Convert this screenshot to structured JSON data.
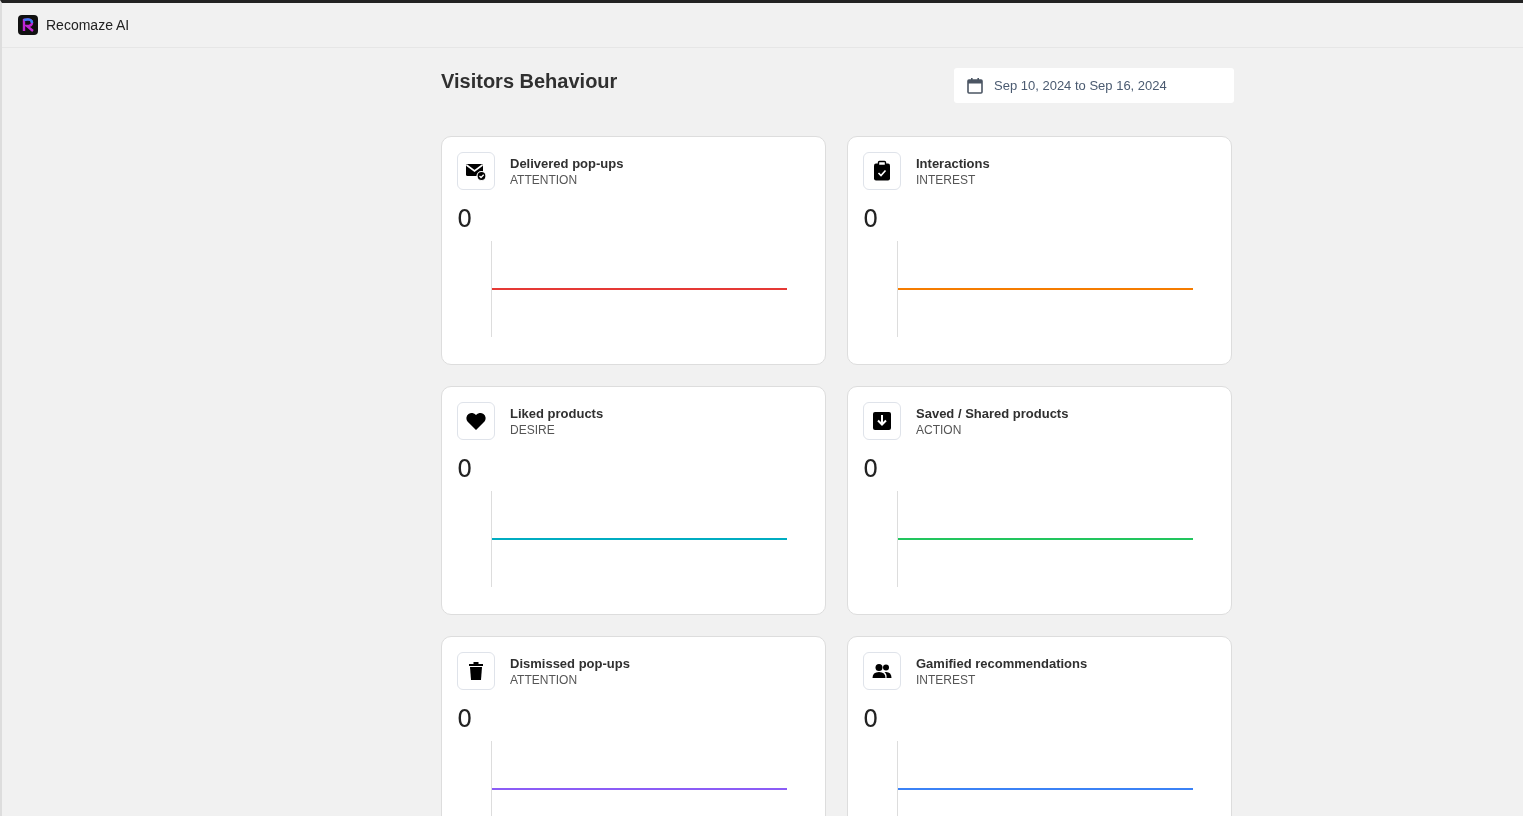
{
  "app": {
    "name": "Recomaze AI"
  },
  "page": {
    "title": "Visitors Behaviour",
    "date_range": "Sep 10, 2024 to Sep 16, 2024"
  },
  "cards": [
    {
      "title": "Delivered pop-ups",
      "stage": "ATTENTION",
      "value": "0",
      "color": "#e53935"
    },
    {
      "title": "Interactions",
      "stage": "INTEREST",
      "value": "0",
      "color": "#f57c00"
    },
    {
      "title": "Liked products",
      "stage": "DESIRE",
      "value": "0",
      "color": "#00acc1"
    },
    {
      "title": "Saved / Shared products",
      "stage": "ACTION",
      "value": "0",
      "color": "#22c55e"
    },
    {
      "title": "Dismissed pop-ups",
      "stage": "ATTENTION",
      "value": "0",
      "color": "#8b5cf6"
    },
    {
      "title": "Gamified recommendations",
      "stage": "INTEREST",
      "value": "0",
      "color": "#3b82f6"
    }
  ]
}
